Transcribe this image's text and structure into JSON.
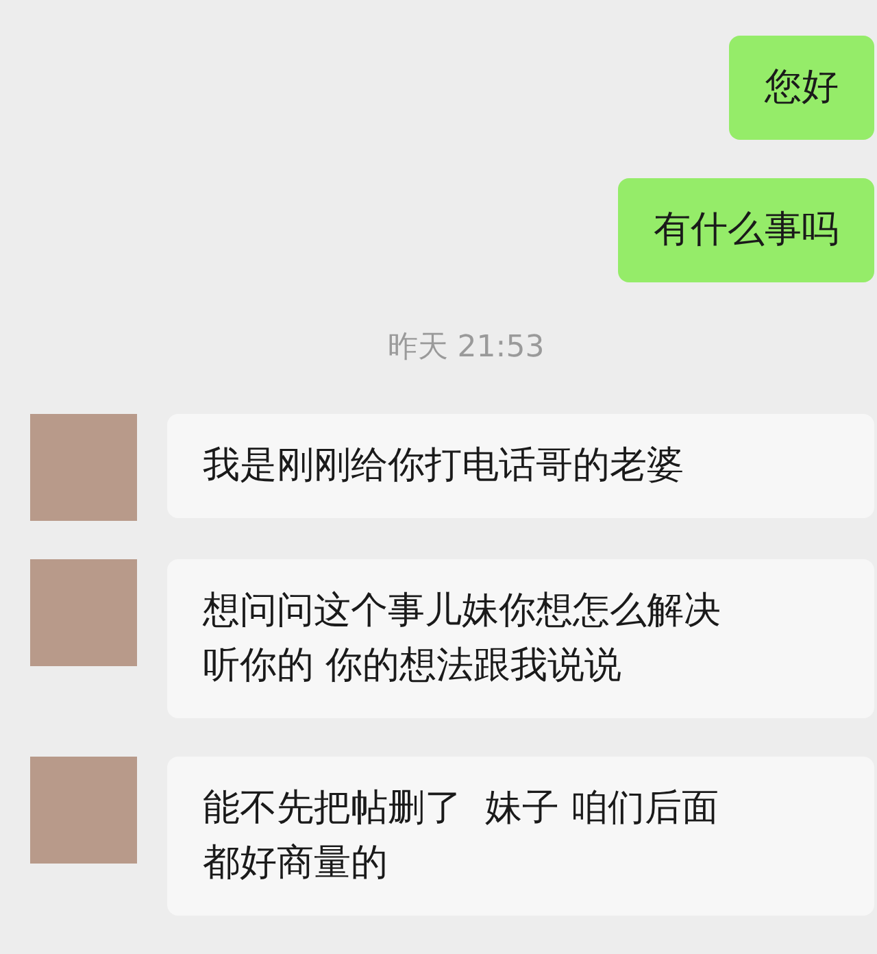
{
  "messages": [
    {
      "kind": "outgoing",
      "text": "您好"
    },
    {
      "kind": "outgoing",
      "text": "有什么事吗"
    },
    {
      "kind": "time",
      "text": "昨天 21:53"
    },
    {
      "kind": "incoming",
      "text": "我是刚刚给你打电话哥的老婆"
    },
    {
      "kind": "incoming",
      "text": "想问问这个事儿妹你想怎么解决听你的 你的想法跟我说说"
    },
    {
      "kind": "incoming",
      "text": "能不先把帖删了  妹子 咱们后面都好商量的"
    }
  ]
}
